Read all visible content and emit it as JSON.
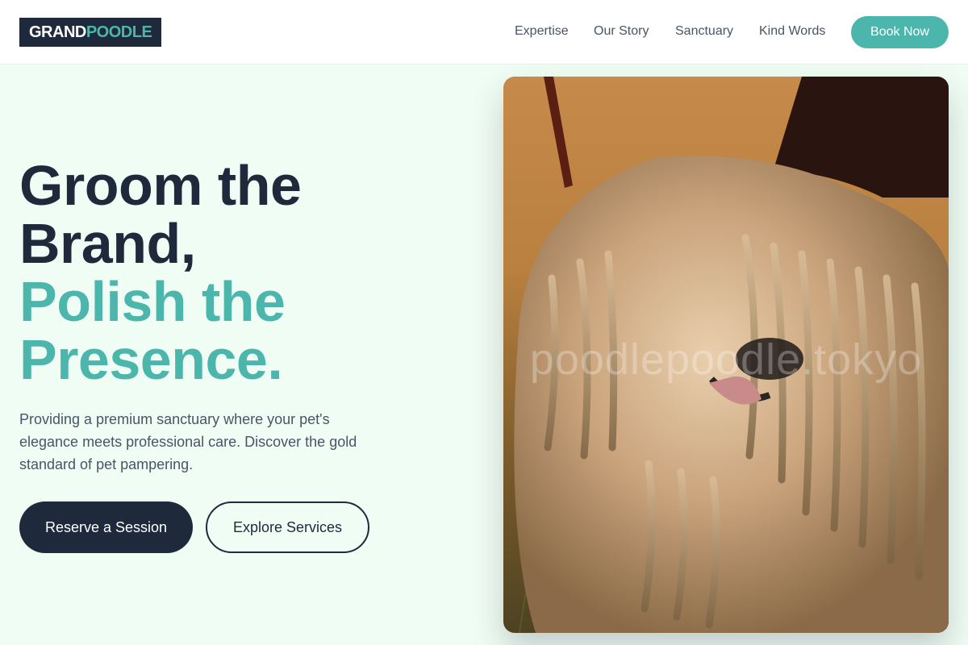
{
  "brand": {
    "part1": "GRAND",
    "part2": "POODLE"
  },
  "nav": {
    "items": [
      {
        "label": "Expertise"
      },
      {
        "label": "Our Story"
      },
      {
        "label": "Sanctuary"
      },
      {
        "label": "Kind Words"
      }
    ],
    "cta": "Book Now"
  },
  "hero": {
    "line1": "Groom the",
    "line2": "Brand,",
    "line3": "Polish the",
    "line4": "Presence.",
    "subtitle": "Providing a premium sanctuary where your pet's elegance meets professional care. Discover the gold standard of pet pampering.",
    "primary_button": "Reserve a Session",
    "secondary_button": "Explore Services"
  },
  "image": {
    "subject": "corded-dog-photo",
    "watermark": "poodlepoodle.tokyo"
  },
  "colors": {
    "navy": "#1e293b",
    "teal": "#4db6ac",
    "background": "#f0fdf4",
    "text_muted": "#475569"
  }
}
